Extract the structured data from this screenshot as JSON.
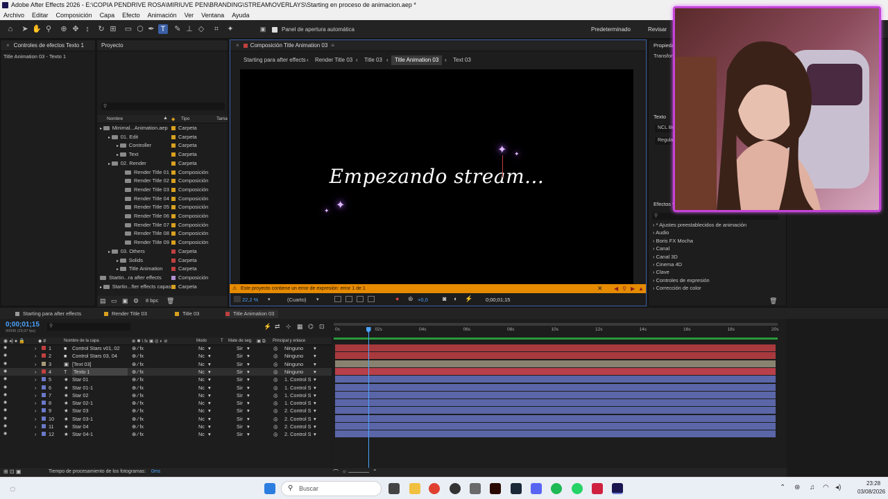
{
  "window": {
    "title": "Adobe After Effects 2026 - E:\\COPIA PENDRIVE ROSA\\MIRIUVE PEN\\BRANDING\\STREAM\\OVERLAYS\\Starting en proceso de animacion.aep *"
  },
  "menu": [
    "Archivo",
    "Editar",
    "Composición",
    "Capa",
    "Efecto",
    "Animación",
    "Ver",
    "Ventana",
    "Ayuda"
  ],
  "toolbar": {
    "auto_open_label": "Panel de apertura automática",
    "workspace": "Predeterminado",
    "review": "Revisar"
  },
  "effects_controls": {
    "tab": "Controles de efectos Texto 1",
    "subtitle": "Title Animation 03 - Texto 1"
  },
  "project": {
    "tab": "Proyecto",
    "col_name": "Nombre",
    "col_type": "Tipo",
    "col_size": "Tama",
    "items": [
      {
        "name": "Minimal...Animation.aep",
        "type": "Carpeta",
        "color": "#d8a020",
        "indent": 0
      },
      {
        "name": "01. Edit",
        "type": "Carpeta",
        "color": "#d8a020",
        "indent": 1
      },
      {
        "name": "Controller",
        "type": "Carpeta",
        "color": "#d8a020",
        "indent": 2
      },
      {
        "name": "Text",
        "type": "Carpeta",
        "color": "#d8a020",
        "indent": 2
      },
      {
        "name": "02. Render",
        "type": "Carpeta",
        "color": "#d8a020",
        "indent": 1
      },
      {
        "name": "Render Title 01",
        "type": "Composición",
        "color": "#d8a020",
        "indent": 3
      },
      {
        "name": "Render Title 02",
        "type": "Composición",
        "color": "#d8a020",
        "indent": 3
      },
      {
        "name": "Render Title 03",
        "type": "Composición",
        "color": "#d8a020",
        "indent": 3
      },
      {
        "name": "Render Title 04",
        "type": "Composición",
        "color": "#d8a020",
        "indent": 3
      },
      {
        "name": "Render Title 05",
        "type": "Composición",
        "color": "#d8a020",
        "indent": 3
      },
      {
        "name": "Render Title 06",
        "type": "Composición",
        "color": "#d8a020",
        "indent": 3
      },
      {
        "name": "Render Title 07",
        "type": "Composición",
        "color": "#d8a020",
        "indent": 3
      },
      {
        "name": "Render Title 08",
        "type": "Composición",
        "color": "#d8a020",
        "indent": 3
      },
      {
        "name": "Render Title 09",
        "type": "Composición",
        "color": "#d8a020",
        "indent": 3
      },
      {
        "name": "03. Others",
        "type": "Carpeta",
        "color": "#c04040",
        "indent": 1
      },
      {
        "name": "Solids",
        "type": "Carpeta",
        "color": "#c04040",
        "indent": 2
      },
      {
        "name": "Title Animation",
        "type": "Carpeta",
        "color": "#c04040",
        "indent": 2
      },
      {
        "name": "Startin...ra after effects",
        "type": "Composición",
        "color": "#b090d0",
        "indent": 0
      },
      {
        "name": "Startin...fter effects capas",
        "type": "Carpeta",
        "color": "#d8a020",
        "indent": 0
      }
    ],
    "bpc": "8 bpc"
  },
  "composition": {
    "tab": "Composición Title Animation 03",
    "breadcrumbs": [
      "Starting para after effects",
      "Render Title 03",
      "Title 03",
      "Title Animation 03",
      "Text 03"
    ],
    "canvas_text": "Empezando stream...",
    "warning": "Este proyecto contiene un error de expresión: error 1 de 1",
    "zoom": "22,2 %",
    "resolution": "(Cuarto)",
    "exposure": "+0,0",
    "timecode": "0;00;01;15"
  },
  "right_panel": {
    "properties": "Propieda",
    "transform": "Transfor",
    "text": "Texto",
    "font": "NCL Be",
    "style": "Regula",
    "effects": "Efectos y",
    "effects_list": [
      "* Ajustes preestablecidos de animación",
      "Audio",
      "Boris FX Mocha",
      "Canal",
      "Canal 3D",
      "Cinema 4D",
      "Clave",
      "Controles de expresión",
      "Corrección de color"
    ]
  },
  "timeline": {
    "tabs": [
      {
        "label": "Starting para after effects",
        "color": "#9a9a9a"
      },
      {
        "label": "Render Title 03",
        "color": "#d8a020"
      },
      {
        "label": "Title 03",
        "color": "#d8a020"
      },
      {
        "label": "Title Animation 03",
        "color": "#c04040"
      }
    ],
    "timecode": "0;00;01;15",
    "fps": "00045 (29,97 fps)",
    "col_layer_name": "Nombre de la capa",
    "col_mode": "Modo",
    "col_t": "T",
    "col_matte": "Mate de seg.",
    "col_parent": "Principal y enlace",
    "ticks": [
      "0s",
      "02s",
      "04s",
      "06s",
      "08s",
      "10s",
      "12s",
      "14s",
      "16s",
      "18s",
      "20s"
    ],
    "layers": [
      {
        "num": "1",
        "name": "Control Stars v01, 02",
        "mode": "Nc",
        "matte": "Sir",
        "parent": "Ninguno",
        "color": "#c04040",
        "bar": "#a83a3e"
      },
      {
        "num": "2",
        "name": "Control Stars 03, 04",
        "mode": "Nc",
        "matte": "Sir",
        "parent": "Ninguno",
        "color": "#c04040",
        "bar": "#a83a3e"
      },
      {
        "num": "3",
        "name": "[Text 03]",
        "mode": "Nc",
        "matte": "Sir",
        "parent": "Ninguno",
        "color": "#a89a7a",
        "bar": "#8a8270"
      },
      {
        "num": "4",
        "name": "Texto 1",
        "mode": "Nc",
        "matte": "Sir",
        "parent": "Ninguno",
        "color": "#c04040",
        "bar": "#b8404a"
      },
      {
        "num": "5",
        "name": "Star 01",
        "mode": "Nc",
        "matte": "Sir",
        "parent": "1. Control S",
        "color": "#6a78c8",
        "bar": "#5a66a8"
      },
      {
        "num": "6",
        "name": "Star 01-1",
        "mode": "Nc",
        "matte": "Sir",
        "parent": "1. Control S",
        "color": "#6a78c8",
        "bar": "#5a66a8"
      },
      {
        "num": "7",
        "name": "Star 02",
        "mode": "Nc",
        "matte": "Sir",
        "parent": "1. Control S",
        "color": "#6a78c8",
        "bar": "#5a66a8"
      },
      {
        "num": "8",
        "name": "Star 02-1",
        "mode": "Nc",
        "matte": "Sir",
        "parent": "1. Control S",
        "color": "#6a78c8",
        "bar": "#5a66a8"
      },
      {
        "num": "9",
        "name": "Star 03",
        "mode": "Nc",
        "matte": "Sir",
        "parent": "2. Control S",
        "color": "#6a78c8",
        "bar": "#5a66a8"
      },
      {
        "num": "10",
        "name": "Star 03-1",
        "mode": "Nc",
        "matte": "Sir",
        "parent": "2. Control S",
        "color": "#6a78c8",
        "bar": "#5a66a8"
      },
      {
        "num": "11",
        "name": "Star 04",
        "mode": "Nc",
        "matte": "Sir",
        "parent": "2. Control S",
        "color": "#6a78c8",
        "bar": "#5a66a8"
      },
      {
        "num": "12",
        "name": "Star 04-1",
        "mode": "Nc",
        "matte": "Sir",
        "parent": "2. Control S",
        "color": "#6a78c8",
        "bar": "#5a66a8"
      }
    ],
    "playhead_seconds": 1.5,
    "duration_seconds": 20,
    "render_time_label": "Tiempo de procesamiento de los fotogramas:",
    "render_time_value": "0ms"
  },
  "taskbar": {
    "search": "Buscar",
    "time": "23:28",
    "date": "03/08/2026"
  }
}
